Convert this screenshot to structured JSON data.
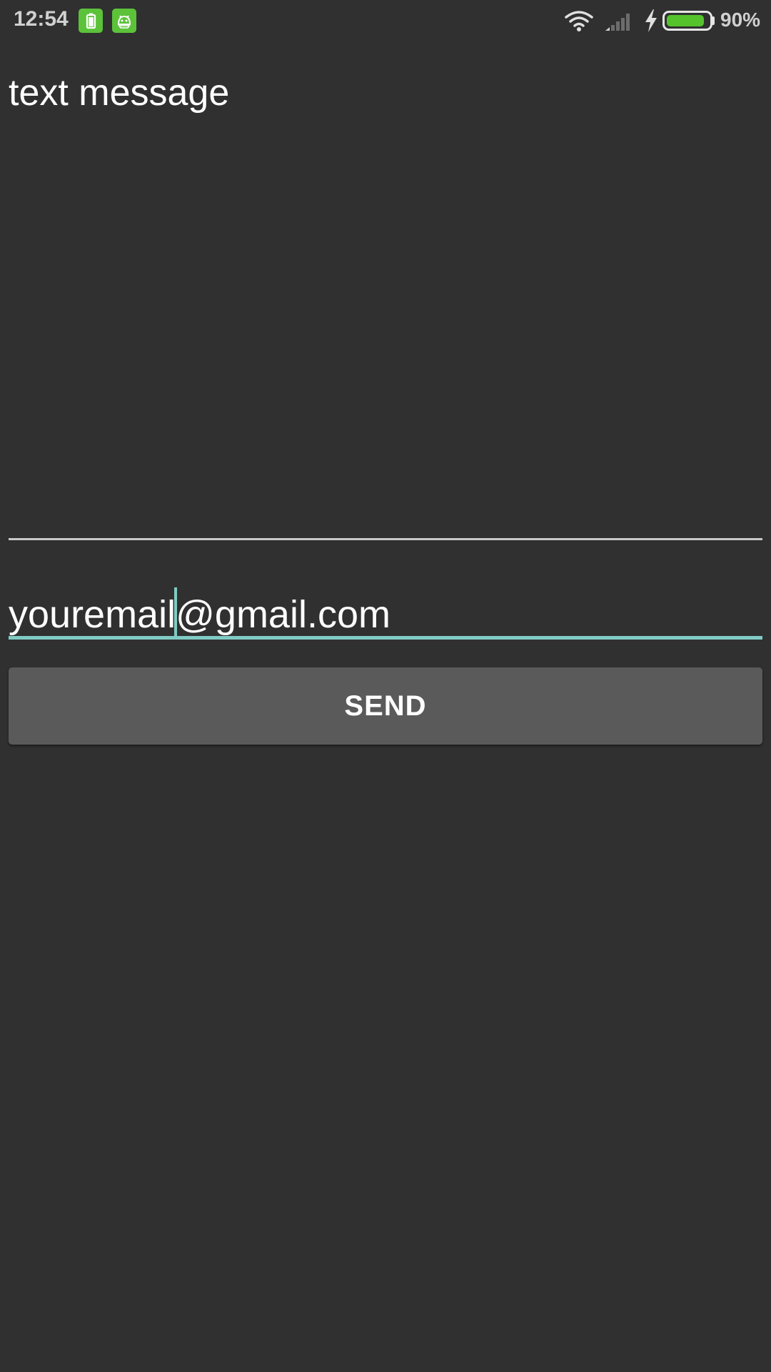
{
  "status_bar": {
    "time": "12:54",
    "notification_icons": [
      "battery-saver-icon",
      "android-icon"
    ],
    "wifi_icon": "wifi-icon",
    "signal_icon": "cell-signal-icon",
    "charging_icon": "charging-bolt-icon",
    "battery_level_percent": 90,
    "battery_percent_label": "90%",
    "battery_color": "#55c32c",
    "notification_icon_color": "#5cc23a"
  },
  "form": {
    "message_value": "text message",
    "email_value_before_cursor": "youremail",
    "email_value_after_cursor": "@gmail.com",
    "accent_color": "#80cbc4",
    "send_label": "SEND"
  }
}
